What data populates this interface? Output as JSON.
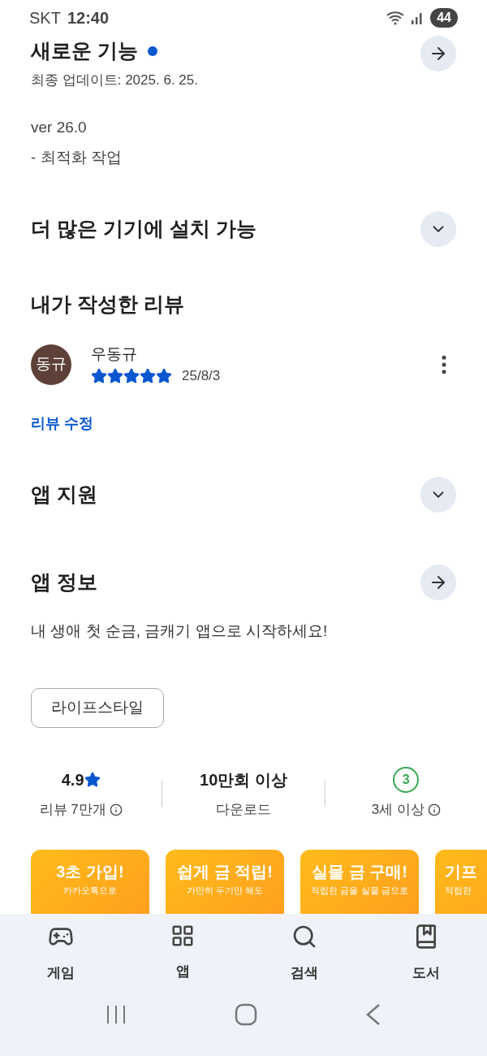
{
  "status_bar": {
    "carrier": "SKT",
    "time": "12:40",
    "battery": "44"
  },
  "whats_new": {
    "title": "새로운 기능",
    "updated": "최종 업데이트: 2025. 6. 25.",
    "version": "ver 26.0",
    "notes": "- 최적화 작업"
  },
  "sections_top": [
    {
      "title": "더 많은 기기에 설치 가능",
      "kind": "expand"
    }
  ],
  "my_review": {
    "title": "내가 작성한 리뷰",
    "avatar": "동규",
    "author": "우동규",
    "stars": 5,
    "date": "25/8/3",
    "edit_link": "리뷰 수정"
  },
  "sections": [
    {
      "title": "앱 지원",
      "kind": "expand"
    },
    {
      "title": "앱 정보",
      "kind": "arrow"
    }
  ],
  "description": "내 생애 첫 순금, 금캐기 앱으로 시작하세요!",
  "category_chip": "라이프스타일",
  "stats": [
    {
      "value": "4.9",
      "kind": "rating",
      "label": "리뷰 7만개",
      "info": true
    },
    {
      "value": "10만회 이상",
      "kind": "text",
      "label": "다운로드",
      "info": false
    },
    {
      "value": "3",
      "kind": "age",
      "label": "3세 이상",
      "info": true
    }
  ],
  "screenshots": [
    {
      "headline": "3초 가입!",
      "caption": "카카오톡으로"
    },
    {
      "headline": "쉽게 금 적립!",
      "caption": "가만히 두기만 해도"
    },
    {
      "headline": "실물 금 구매!",
      "caption": "적립한 금을 실물 금으로"
    },
    {
      "headline": "기프",
      "caption": "적립한"
    }
  ],
  "bottom_nav": [
    {
      "label": "게임"
    },
    {
      "label": "앱"
    },
    {
      "label": "검색"
    },
    {
      "label": "도서"
    }
  ]
}
